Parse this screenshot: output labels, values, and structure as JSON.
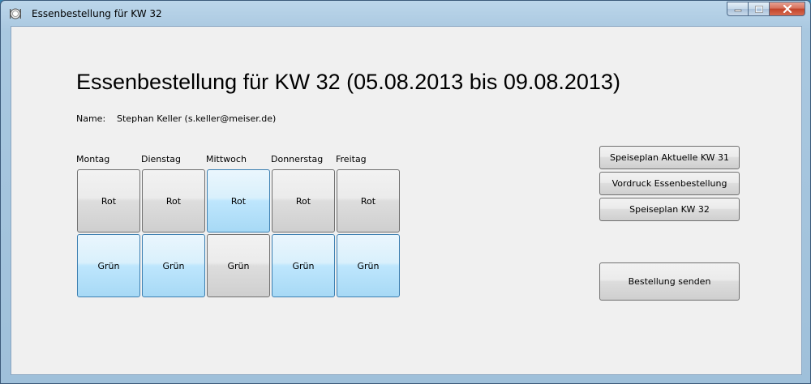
{
  "window": {
    "title": "Essenbestellung für KW 32"
  },
  "heading": "Essenbestellung für KW 32 (05.08.2013 bis 09.08.2013)",
  "name": {
    "label": "Name:",
    "value": "Stephan Keller (s.keller@meiser.de)"
  },
  "days": [
    {
      "label": "Montag",
      "rot": "Rot",
      "rot_selected": false,
      "gruen": "Grün",
      "gruen_selected": true
    },
    {
      "label": "Dienstag",
      "rot": "Rot",
      "rot_selected": false,
      "gruen": "Grün",
      "gruen_selected": true
    },
    {
      "label": "Mittwoch",
      "rot": "Rot",
      "rot_selected": true,
      "gruen": "Grün",
      "gruen_selected": false
    },
    {
      "label": "Donnerstag",
      "rot": "Rot",
      "rot_selected": false,
      "gruen": "Grün",
      "gruen_selected": true
    },
    {
      "label": "Freitag",
      "rot": "Rot",
      "rot_selected": false,
      "gruen": "Grün",
      "gruen_selected": true
    }
  ],
  "buttons": {
    "speiseplan_aktuell": "Speiseplan Aktuelle KW 31",
    "vordruck": "Vordruck Essenbestellung",
    "speiseplan_kw32": "Speiseplan KW 32",
    "senden": "Bestellung senden"
  },
  "colors": {
    "selected": "#bee6fd",
    "unselected": "#dddddd",
    "close_button": "#c2442a"
  },
  "icons": {
    "app": "food-plate-icon",
    "minimize": "minimize-icon",
    "maximize": "maximize-icon",
    "close": "close-icon"
  }
}
